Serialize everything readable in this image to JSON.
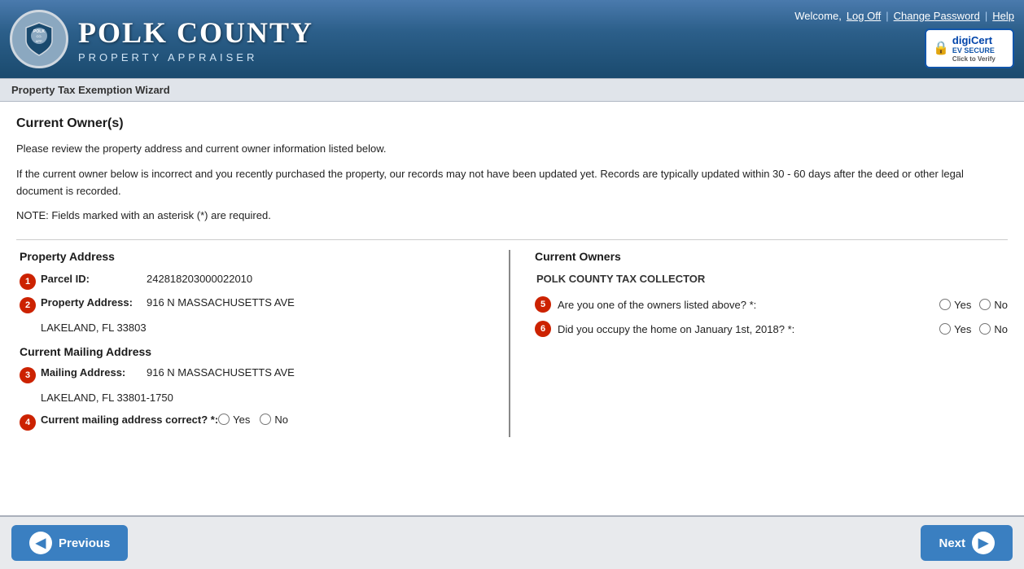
{
  "header": {
    "title": "POLK COUNTY",
    "subtitle": "PROPERTY APPRAISER",
    "welcome_text": "Welcome,",
    "log_off_label": "Log Off",
    "change_password_label": "Change Password",
    "help_label": "Help",
    "digicert_label": "digi",
    "digicert_cert": "cert",
    "ev_secure_label": "EV SECURE",
    "click_verify_label": "Click to Verify"
  },
  "breadcrumb": {
    "title": "Property Tax Exemption Wizard"
  },
  "page": {
    "section_title": "Current Owner(s)",
    "intro1": "Please review the property address and current owner information listed below.",
    "intro2": "If the current owner below is incorrect and you recently purchased the property, our records may not have been updated yet. Records are typically updated within 30 - 60 days after the deed or other legal document is recorded.",
    "note": "NOTE: Fields marked with an asterisk (*) are required."
  },
  "property_address": {
    "section_title": "Property Address",
    "parcel_label": "Parcel ID:",
    "parcel_value": "242818203000022010",
    "address_label": "Property Address:",
    "address_line1": "916 N MASSACHUSETTS AVE",
    "address_line2": "LAKELAND, FL 33803",
    "mailing_section_title": "Current Mailing Address",
    "mailing_label": "Mailing Address:",
    "mailing_line1": "916 N MASSACHUSETTS AVE",
    "mailing_line2": "LAKELAND, FL 33801-1750",
    "mailing_correct_label": "Current mailing address correct? *:",
    "yes_label": "Yes",
    "no_label": "No",
    "step_numbers": [
      "1",
      "2",
      "3",
      "4"
    ]
  },
  "current_owners": {
    "section_title": "Current Owners",
    "owner_name": "POLK COUNTY TAX COLLECTOR",
    "question5_text": "Are you one of the owners listed above? *:",
    "question6_text": "Did you occupy the home on January 1st, 2018? *:",
    "yes_label": "Yes",
    "no_label": "No",
    "step_numbers": [
      "5",
      "6"
    ]
  },
  "footer": {
    "previous_label": "Previous",
    "next_label": "Next"
  }
}
